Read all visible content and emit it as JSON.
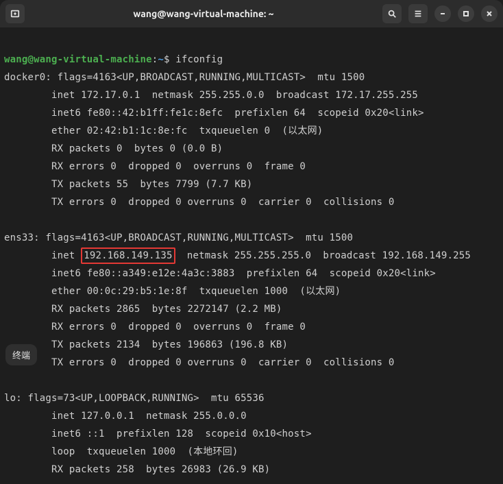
{
  "window": {
    "title": "wang@wang-virtual-machine: ~"
  },
  "prompt": {
    "user_host": "wang@wang-virtual-machine",
    "separator": ":",
    "path": "~",
    "symbol": "$",
    "command": "ifconfig"
  },
  "interfaces": {
    "docker0": {
      "header": "docker0: flags=4163<UP,BROADCAST,RUNNING,MULTICAST>  mtu 1500",
      "inet": "        inet 172.17.0.1  netmask 255.255.0.0  broadcast 172.17.255.255",
      "inet6": "        inet6 fe80::42:b1ff:fe1c:8efc  prefixlen 64  scopeid 0x20<link>",
      "ether": "        ether 02:42:b1:1c:8e:fc  txqueuelen 0  (以太网)",
      "rxp": "        RX packets 0  bytes 0 (0.0 B)",
      "rxe": "        RX errors 0  dropped 0  overruns 0  frame 0",
      "txp": "        TX packets 55  bytes 7799 (7.7 KB)",
      "txe": "        TX errors 0  dropped 0 overruns 0  carrier 0  collisions 0"
    },
    "ens33": {
      "header": "ens33: flags=4163<UP,BROADCAST,RUNNING,MULTICAST>  mtu 1500",
      "inet_prefix": "        inet ",
      "inet_ip": "192.168.149.135",
      "inet_suffix": "  netmask 255.255.255.0  broadcast 192.168.149.255",
      "inet6": "        inet6 fe80::a349:e12e:4a3c:3883  prefixlen 64  scopeid 0x20<link>",
      "ether": "        ether 00:0c:29:b5:1e:8f  txqueuelen 1000  (以太网)",
      "rxp": "        RX packets 2865  bytes 2272147 (2.2 MB)",
      "rxe": "        RX errors 0  dropped 0  overruns 0  frame 0",
      "txp": "        TX packets 2134  bytes 196863 (196.8 KB)",
      "txe": "        TX errors 0  dropped 0 overruns 0  carrier 0  collisions 0"
    },
    "lo": {
      "header": "lo: flags=73<UP,LOOPBACK,RUNNING>  mtu 65536",
      "inet": "        inet 127.0.0.1  netmask 255.0.0.0",
      "inet6": "        inet6 ::1  prefixlen 128  scopeid 0x10<host>",
      "loop": "        loop  txqueuelen 1000  (本地环回)",
      "rxp": "        RX packets 258  bytes 26983 (26.9 KB)"
    }
  },
  "badge": {
    "label": "终端"
  }
}
